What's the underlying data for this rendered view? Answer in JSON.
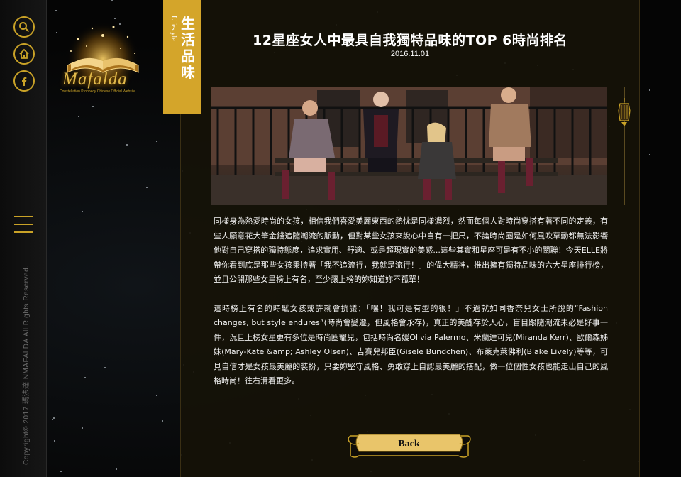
{
  "logo": {
    "name": "Mafalda",
    "subtitle": "Constellation Prophecy Chinese Official Website"
  },
  "rail": {
    "buttons": [
      {
        "icon": "search-icon"
      },
      {
        "icon": "home-icon"
      },
      {
        "icon": "facebook-icon"
      }
    ],
    "menu_icon": "hamburger-icon",
    "copyright": "Copyright© 2017 瑪法達  NMAFALDA All Rights Reserved."
  },
  "category": {
    "label_zh": "生活品味",
    "label_en": "Lifestyle"
  },
  "article": {
    "title": "12星座女人中最具自我獨特品味的TOP 6時尚排名",
    "date": "2016.11.01",
    "paragraphs": [
      "同樣身為熱愛時尚的女孩，相信我們喜愛美麗東西的熱忱是同樣濃烈，然而每個人對時尚穿搭有著不同的定義，有些人願意花大筆金錢追隨潮流的脈動，但對某些女孩來說心中自有一把尺，不論時尚圈是如何風吹草動都無法影響他對自己穿搭的獨特態度，追求實用、舒適、或是超現實的美感...這些其實和星座可是有不小的關聯！今天ELLE將帶你看到底是那些女孩秉持著「我不追流行，我就是流行！」的偉大精神，推出擁有獨特品味的六大星座排行榜，並且公開那些女星榜上有名，至少讓上榜的妳知道妳不孤單！",
      "這時榜上有名的時髦女孩或許就會抗議：「嘿！我可是有型的很！」不過就如同香奈兒女士所說的“Fashion changes, but style endures”(時尚會變遷，但風格會永存)，真正的美醜存於人心，盲目跟隨潮流未必是好事一件，況且上榜女星更有多位是時尚圈寵兒，包括時尚名媛Olivia Palermo、米蘭達可兒(Miranda Kerr)、歐爾森姊妹(Mary-Kate &amp; Ashley Olsen)、吉賽兒邦臣(Gisele Bundchen)、布萊克萊佛利(Blake Lively)等等，可見自信才是女孩最美麗的裝扮，只要妳堅守風格、勇敢穿上自認最美麗的搭配，做一位個性女孩也能走出自己的風格時尚！往右滑看更多。"
    ]
  },
  "back_button": {
    "label": "Back"
  },
  "colors": {
    "accent": "#c9a227",
    "category_bg": "#d4a52a",
    "panel_bg": "#16120a"
  }
}
